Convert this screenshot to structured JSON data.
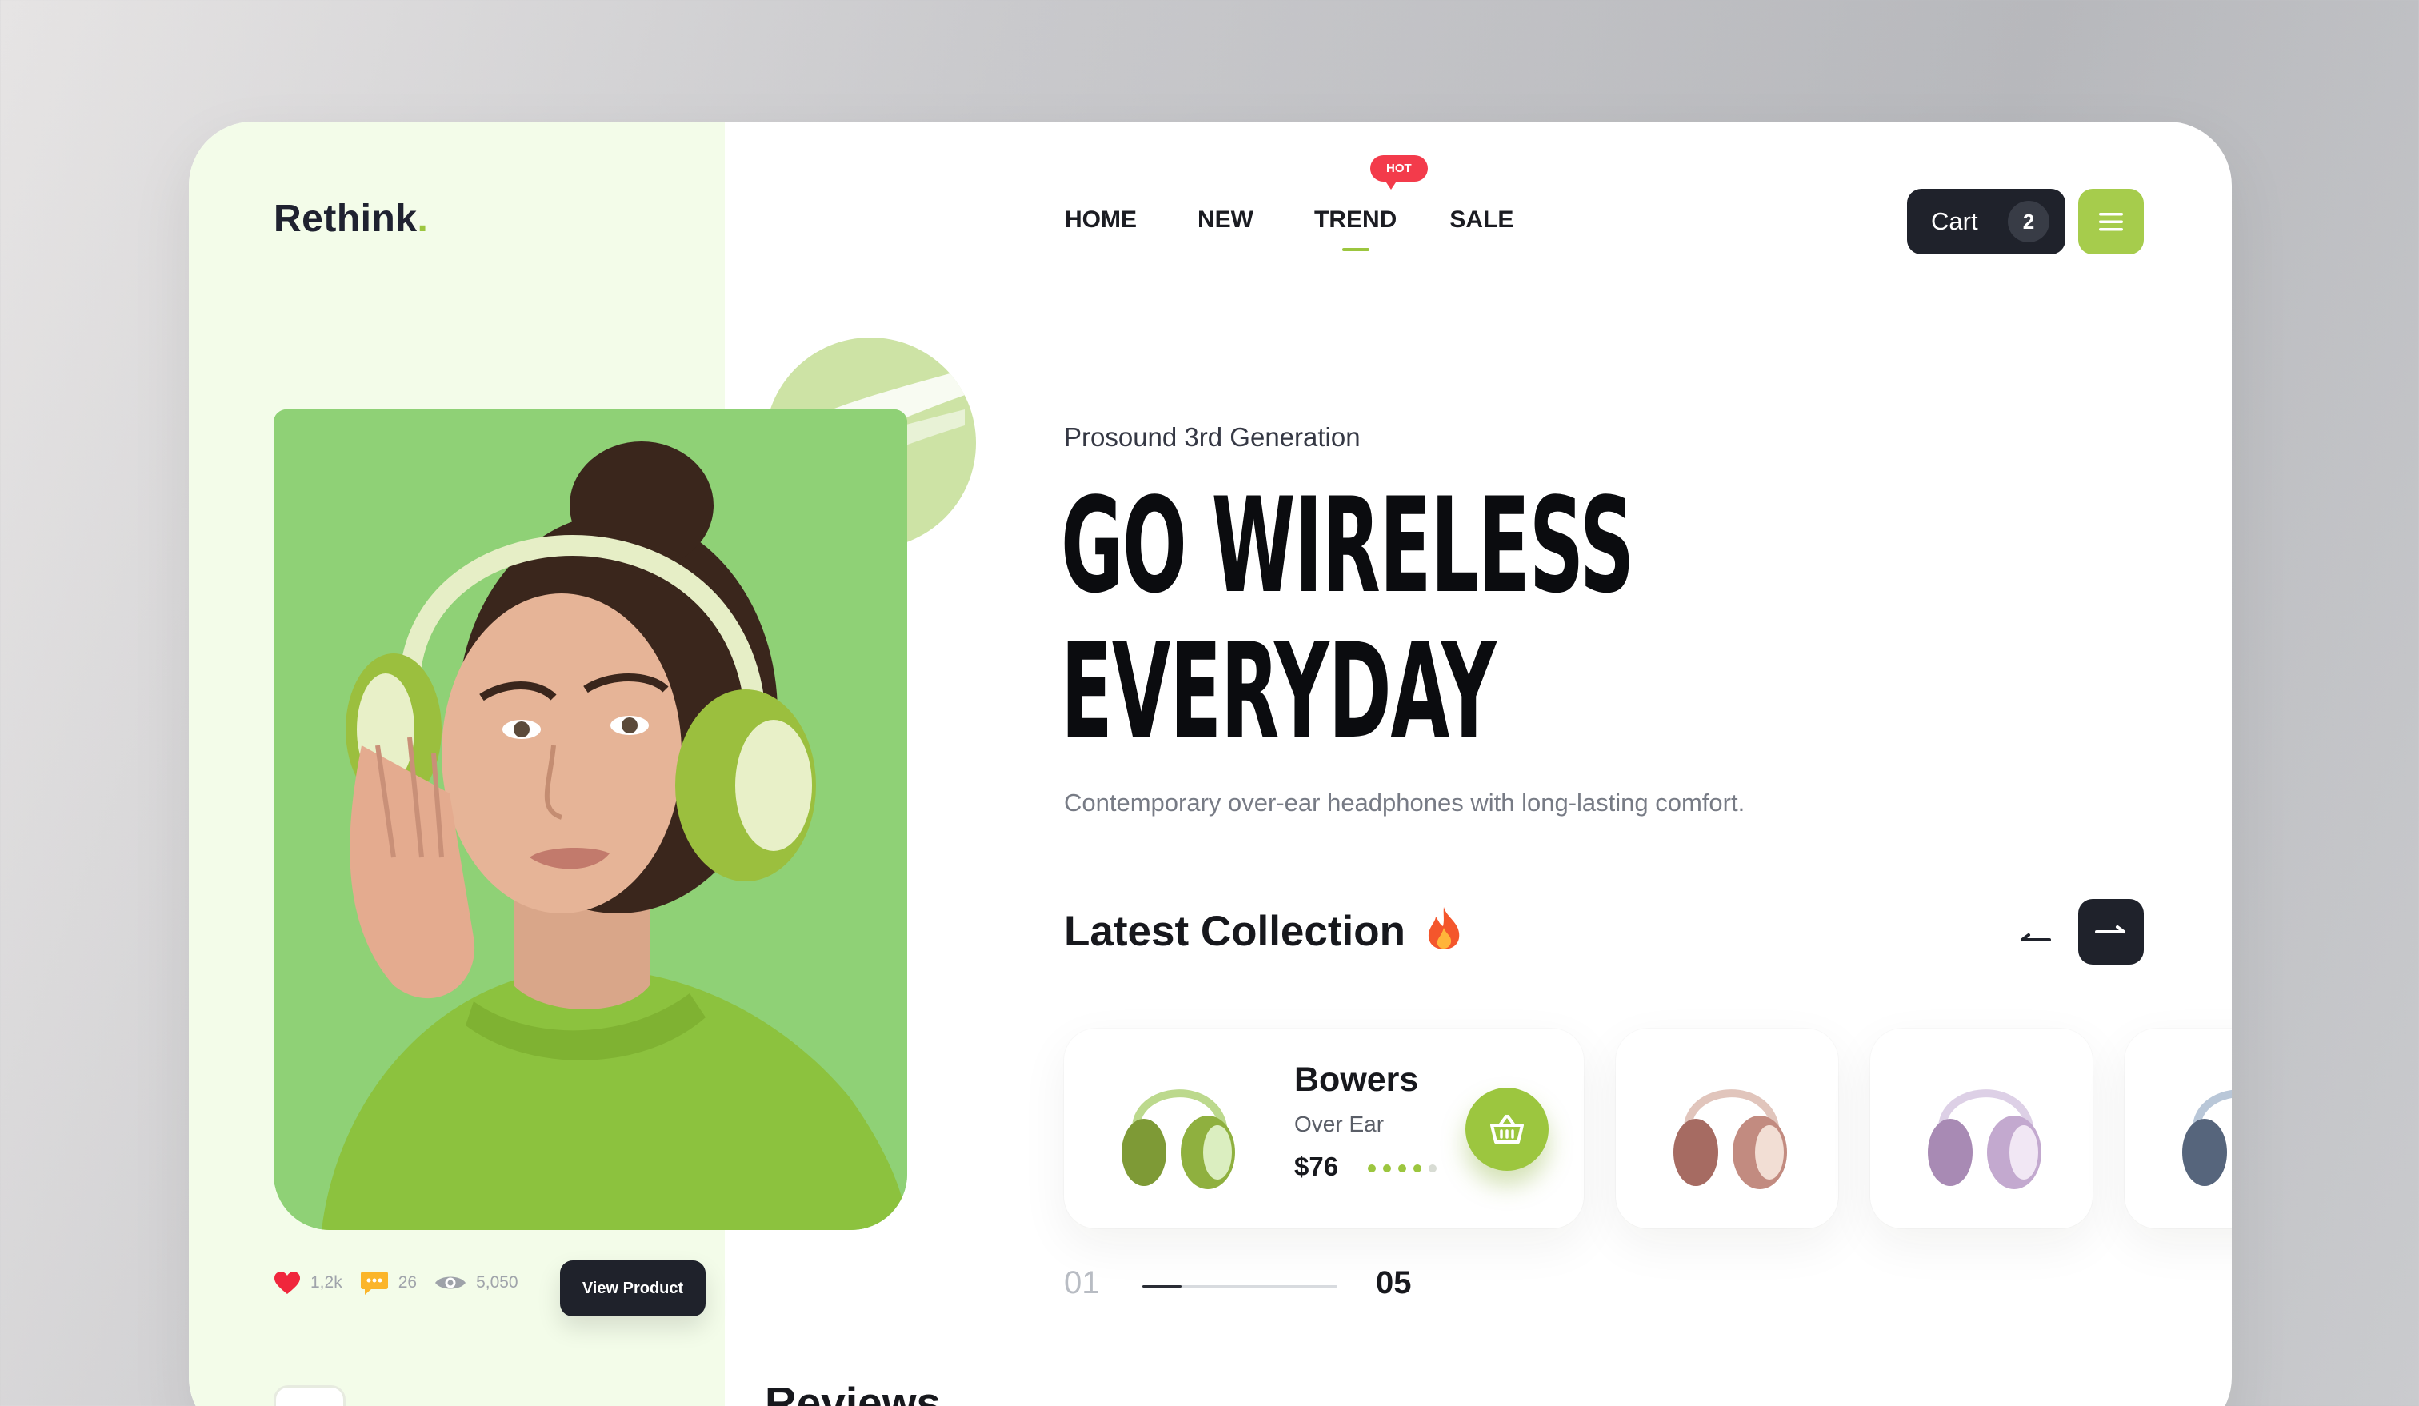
{
  "brand": {
    "name": "Rethink",
    "dot": "."
  },
  "nav": {
    "items": [
      {
        "label": "HOME"
      },
      {
        "label": "NEW"
      },
      {
        "label": "TREND",
        "badge": "HOT",
        "active": true
      },
      {
        "label": "SALE"
      }
    ]
  },
  "cart": {
    "label": "Cart",
    "count": "2"
  },
  "hero": {
    "subtitle": "Prosound 3rd Generation",
    "headline_line1": "GO WIRELESS",
    "headline_line2": "EVERYDAY",
    "description": "Contemporary over-ear headphones with long-lasting comfort."
  },
  "stats": {
    "likes": "1,2k",
    "comments": "26",
    "views": "5,050"
  },
  "view_product_label": "View Product",
  "latest": {
    "title": "Latest Collection"
  },
  "featured_product": {
    "name": "Bowers",
    "type": "Over Ear",
    "price": "$76",
    "rating": 4,
    "rating_max": 5
  },
  "pager": {
    "current": "01",
    "total": "05",
    "progress": 0.2
  },
  "reviews": {
    "title": "Reviews"
  },
  "colors": {
    "accent": "#9cc63f",
    "dark": "#1f222b",
    "hot": "#f33b4b",
    "panel": "#f3fce9",
    "hero_bg": "#8fd176"
  },
  "icons": {
    "menu": "hamburger-icon",
    "like": "heart-icon",
    "comment": "chat-bubble-icon",
    "views": "eye-icon",
    "prev": "arrow-left-icon",
    "next": "arrow-right-icon",
    "basket": "basket-icon",
    "fire": "fire-icon"
  }
}
